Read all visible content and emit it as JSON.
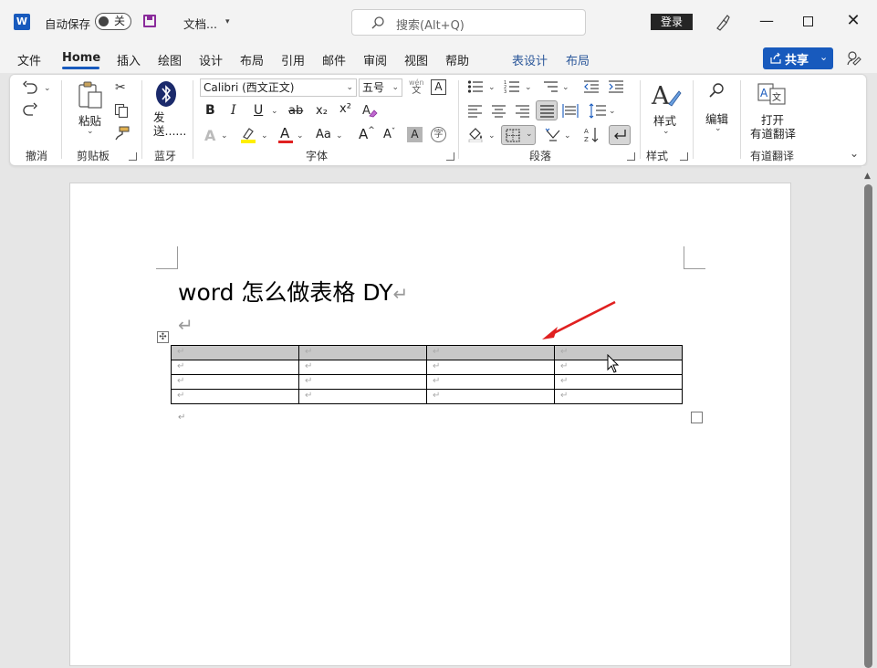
{
  "titlebar": {
    "logo": "W",
    "autosave_label": "自动保存",
    "autosave_state": "关",
    "filename": "文档...",
    "search_placeholder": "搜索(Alt+Q)",
    "login_label": "登录"
  },
  "menu": {
    "tabs": [
      "文件",
      "Home",
      "插入",
      "绘图",
      "设计",
      "布局",
      "引用",
      "邮件",
      "审阅",
      "视图",
      "帮助",
      "表设计",
      "布局"
    ],
    "active_tab": "Home",
    "share_label": "共享"
  },
  "ribbon": {
    "undo_group": "撤消",
    "clipboard": {
      "paste_label": "粘贴",
      "group": "剪贴板"
    },
    "bluetooth": {
      "label": "发送......",
      "group": "蓝牙"
    },
    "font": {
      "family": "Calibri (西文正文)",
      "size": "五号",
      "group": "字体",
      "bold": "B",
      "italic": "I",
      "underline": "U",
      "strike": "ab",
      "sub": "x₂",
      "sup": "x²",
      "case": "Aa",
      "grow": "A",
      "shrink": "A"
    },
    "paragraph": {
      "group": "段落"
    },
    "styles": {
      "label": "样式",
      "group": "样式"
    },
    "editing": {
      "label": "编辑"
    },
    "youdao": {
      "label_line1": "打开",
      "label_line2": "有道翻译",
      "group": "有道翻译"
    }
  },
  "document": {
    "title": "word 怎么做表格 DY",
    "para_mark": "↵",
    "table": {
      "rows": 4,
      "cols": 4,
      "cell_mark": "↵",
      "selected_row": 0
    }
  },
  "colors": {
    "accent": "#185abd",
    "arrow": "#e02020",
    "selected_row_bg": "#c8c8c8"
  }
}
